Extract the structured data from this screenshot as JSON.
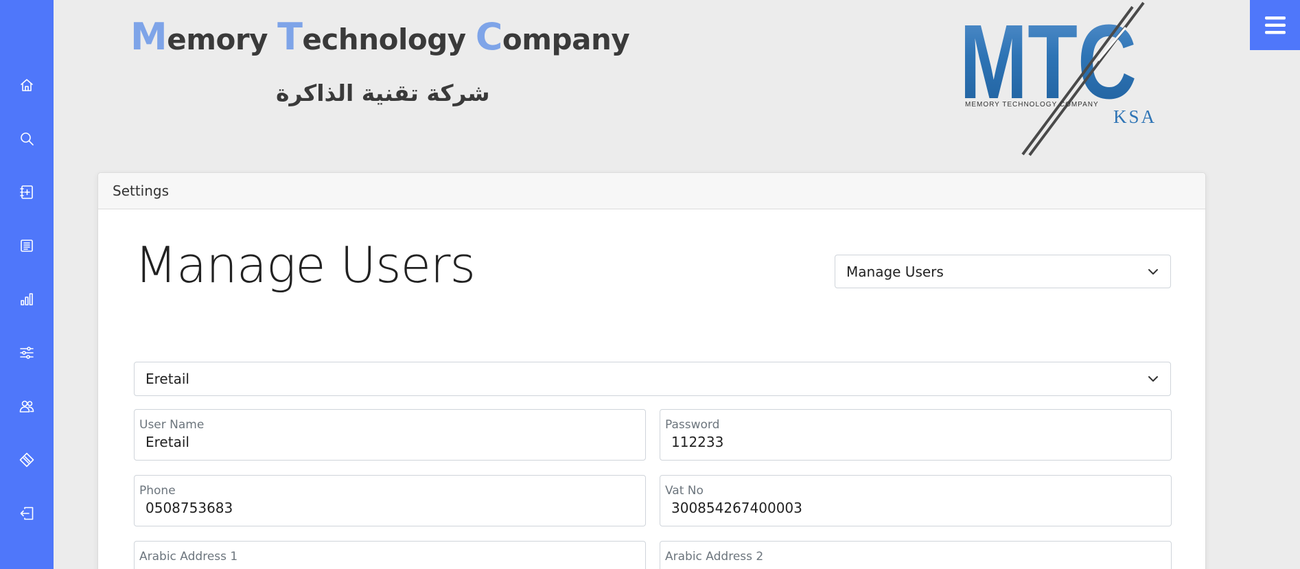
{
  "header": {
    "company_name_parts": [
      {
        "initial": "M",
        "rest": "emory "
      },
      {
        "initial": "T",
        "rest": "echnology "
      },
      {
        "initial": "C",
        "rest": "ompany"
      }
    ],
    "company_name_arabic": "شركة تقنية الذاكرة",
    "logo": {
      "letters": "MTC",
      "tagline": "MEMORY  TECHNOLOGY  COMPANY",
      "region": "KSA"
    }
  },
  "sidebar": {
    "items": [
      {
        "icon": "home-icon"
      },
      {
        "icon": "search-icon"
      },
      {
        "icon": "add-invoice-icon"
      },
      {
        "icon": "invoice-list-icon"
      },
      {
        "icon": "bar-chart-icon"
      },
      {
        "icon": "sliders-icon"
      },
      {
        "icon": "users-icon"
      },
      {
        "icon": "diamond-icon"
      },
      {
        "icon": "logout-icon"
      }
    ]
  },
  "card": {
    "header_label": "Settings",
    "page_title": "Manage Users",
    "section_select": {
      "selected": "Manage Users"
    },
    "company_select": {
      "selected": "Eretail"
    },
    "fields": {
      "user_name": {
        "label": "User Name",
        "value": "Eretail"
      },
      "password": {
        "label": "Password",
        "value": "112233"
      },
      "phone": {
        "label": "Phone",
        "value": "0508753683"
      },
      "vat_no": {
        "label": "Vat No",
        "value": "300854267400003"
      },
      "arabic_address_1": {
        "label": "Arabic Address 1",
        "value": ""
      },
      "arabic_address_2": {
        "label": "Arabic Address 2",
        "value": ""
      }
    }
  },
  "colors": {
    "sidebar": "#4f77fa",
    "accent_initial": "#7ea4e8",
    "logo_blue": "#2e74b5"
  }
}
